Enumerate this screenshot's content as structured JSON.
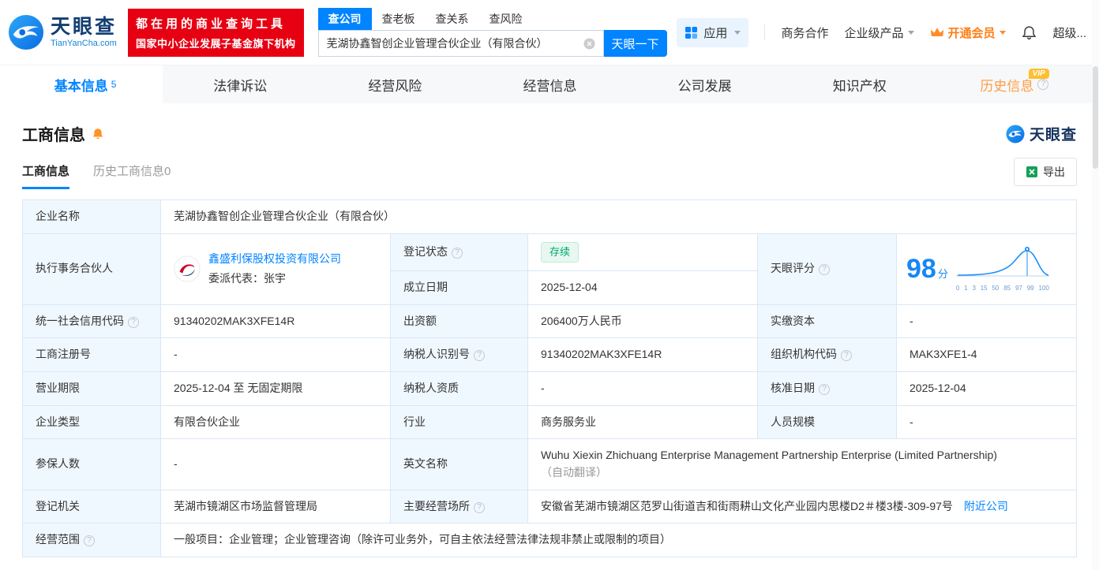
{
  "colors": {
    "primary": "#0084ff",
    "brand_red": "#e60012",
    "vip_orange": "#ff7e14",
    "history_orange": "#ff9d42",
    "status_green": "#00a96c"
  },
  "icons": {
    "help": "?"
  },
  "header": {
    "brand": {
      "name": "天眼查",
      "domain": "TianYanCha.com"
    },
    "promo": {
      "line1": "都在用的商业查询工具",
      "line2": "国家中小企业发展子基金旗下机构"
    },
    "search_tabs": [
      {
        "label": "查公司",
        "active": true
      },
      {
        "label": "查老板",
        "active": false
      },
      {
        "label": "查关系",
        "active": false
      },
      {
        "label": "查风险",
        "active": false
      }
    ],
    "search": {
      "value": "芜湖协鑫智创企业管理合伙企业（有限合伙）",
      "button": "天眼一下"
    },
    "nav": {
      "apps": "应用",
      "biz": "商务合作",
      "enterprise": "企业级产品",
      "vip": "开通会员",
      "super": "超级..."
    }
  },
  "tabs": [
    {
      "label": "基本信息",
      "count": "5"
    },
    {
      "label": "法律诉讼"
    },
    {
      "label": "经营风险"
    },
    {
      "label": "经营信息"
    },
    {
      "label": "公司发展"
    },
    {
      "label": "知识产权"
    },
    {
      "label": "历史信息",
      "badge": "VIP"
    }
  ],
  "section": {
    "title": "工商信息",
    "brand": "天眼查",
    "subtabs": [
      {
        "label": "工商信息",
        "active": true
      },
      {
        "label": "历史工商信息0",
        "active": false
      }
    ],
    "export": "导出"
  },
  "score": {
    "label": "天眼评分",
    "value": "98",
    "unit": "分",
    "axis": [
      "0",
      "1",
      "3",
      "15",
      "50",
      "85",
      "97",
      "99",
      "100"
    ]
  },
  "fields": {
    "name": {
      "label": "企业名称",
      "value": "芜湖协鑫智创企业管理合伙企业（有限合伙）"
    },
    "partner": {
      "label": "执行事务合伙人",
      "company": "鑫盛利保股权投资有限公司",
      "rep": "委派代表：张宇"
    },
    "status": {
      "label": "登记状态",
      "value": "存续"
    },
    "established": {
      "label": "成立日期",
      "value": "2025-12-04"
    },
    "credit_code": {
      "label": "统一社会信用代码",
      "value": "91340202MAK3XFE14R"
    },
    "capital": {
      "label": "出资额",
      "value": "206400万人民币"
    },
    "paid_capital": {
      "label": "实缴资本",
      "value": "-"
    },
    "reg_no": {
      "label": "工商注册号",
      "value": "-"
    },
    "taxpayer_no": {
      "label": "纳税人识别号",
      "value": "91340202MAK3XFE14R"
    },
    "org_code": {
      "label": "组织机构代码",
      "value": "MAK3XFE1-4"
    },
    "term": {
      "label": "营业期限",
      "value": "2025-12-04 至 无固定期限"
    },
    "taxpayer_quality": {
      "label": "纳税人资质",
      "value": "-"
    },
    "approval_date": {
      "label": "核准日期",
      "value": "2025-12-04"
    },
    "type": {
      "label": "企业类型",
      "value": "有限合伙企业"
    },
    "industry": {
      "label": "行业",
      "value": "商务服务业"
    },
    "staff": {
      "label": "人员规模",
      "value": "-"
    },
    "insured": {
      "label": "参保人数",
      "value": "-"
    },
    "en_name": {
      "label": "英文名称",
      "value": "Wuhu Xiexin Zhichuang Enterprise Management Partnership Enterprise (Limited Partnership)",
      "note": "（自动翻译）"
    },
    "authority": {
      "label": "登记机关",
      "value": "芜湖市镜湖区市场监督管理局"
    },
    "address": {
      "label": "主要经营场所",
      "value": "安徽省芜湖市镜湖区范罗山街道吉和街雨耕山文化产业园内思楼D2＃楼3楼-309-97号",
      "link": "附近公司"
    },
    "scope": {
      "label": "经营范围",
      "value": "一般项目：企业管理；企业管理咨询（除许可业务外，可自主依法经营法律法规非禁止或限制的项目）"
    }
  }
}
